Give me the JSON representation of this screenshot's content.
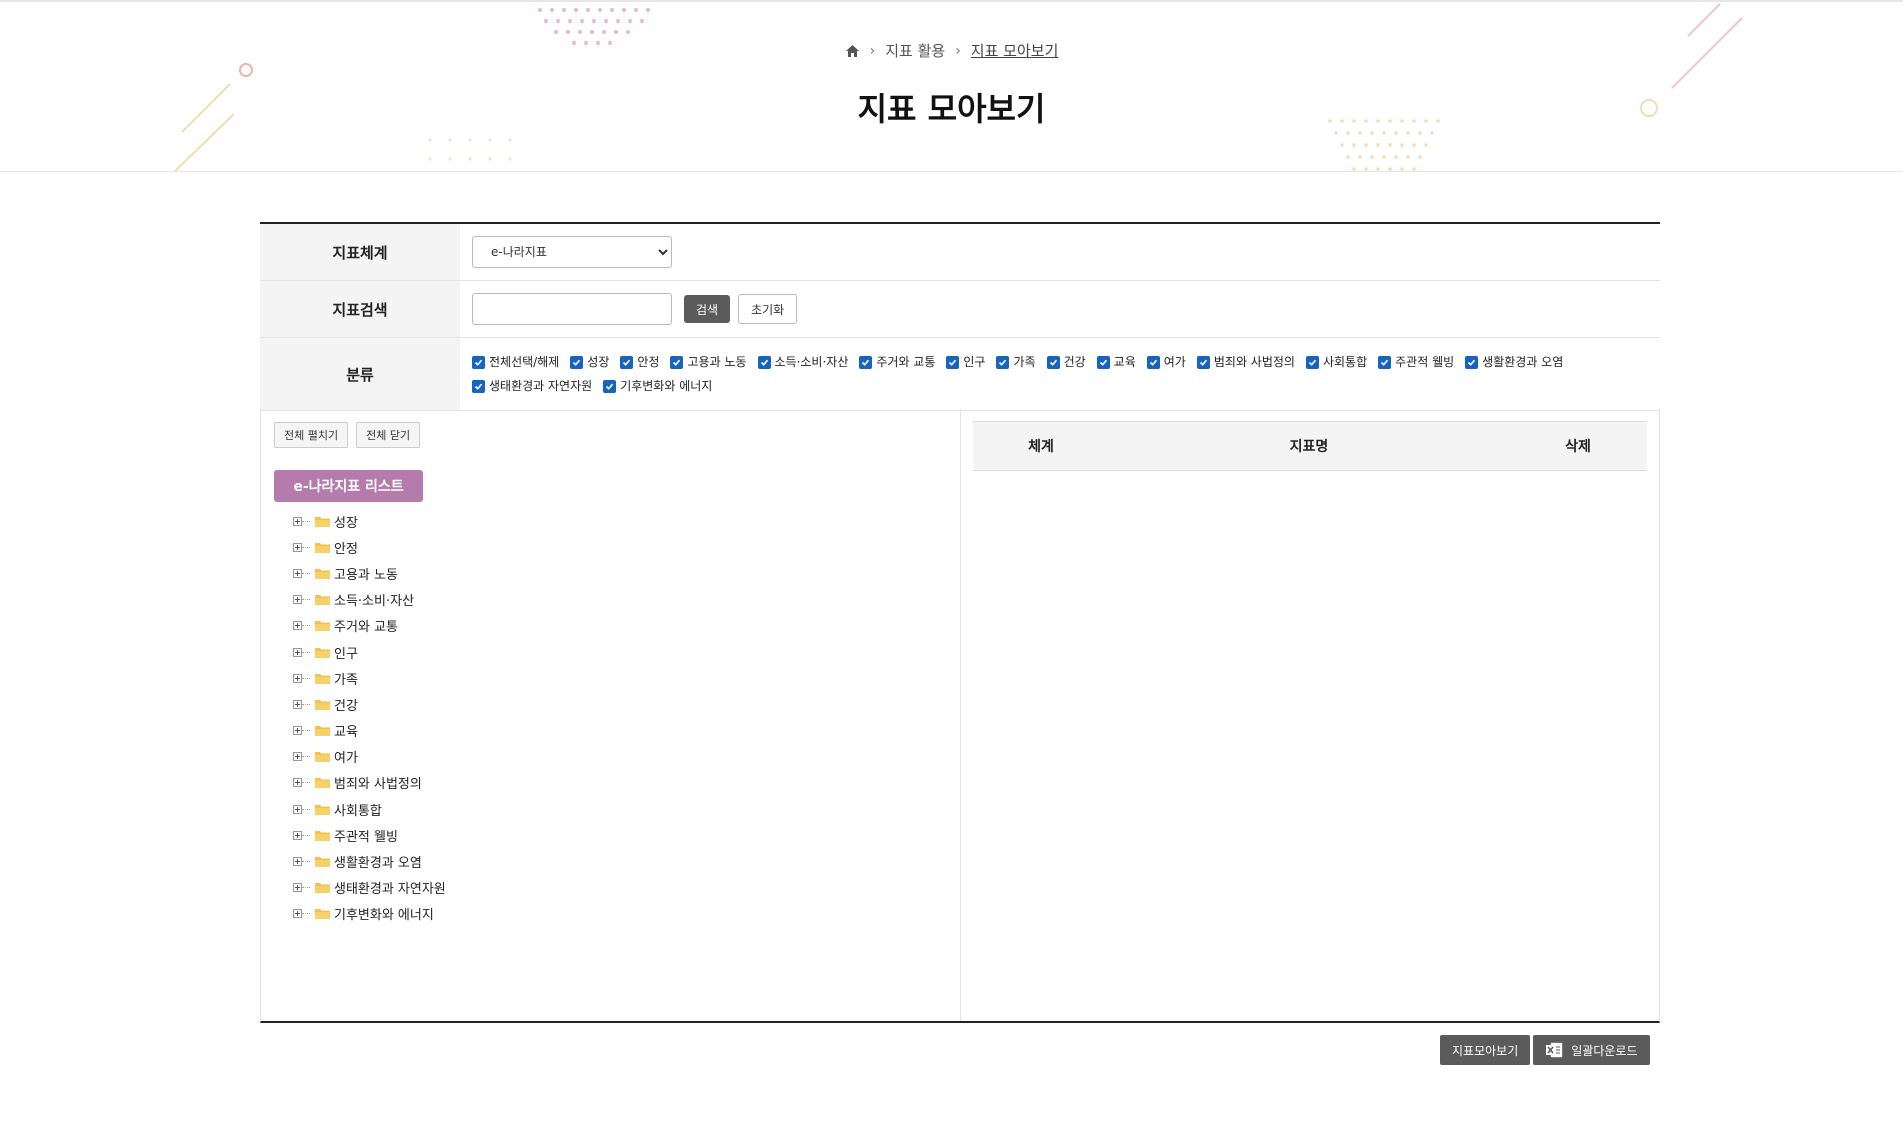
{
  "breadcrumb": {
    "level1": "지표 활용",
    "level2": "지표 모아보기"
  },
  "page_title": "지표 모아보기",
  "form": {
    "system_label": "지표체계",
    "system_selected": "e-나라지표",
    "search_label": "지표검색",
    "search_value": "",
    "search_button": "검색",
    "reset_button": "초기화",
    "category_label": "분류",
    "categories": [
      "전체선택/해제",
      "성장",
      "안정",
      "고용과 노동",
      "소득·소비·자산",
      "주거와 교통",
      "인구",
      "가족",
      "건강",
      "교육",
      "여가",
      "범죄와 사법정의",
      "사회통합",
      "주관적 웰빙",
      "생활환경과 오염",
      "생태환경과 자연자원",
      "기후변화와 에너지"
    ]
  },
  "left_panel": {
    "expand_all": "전체 펼치기",
    "collapse_all": "전체 닫기",
    "list_title": "e-나라지표 리스트",
    "tree_items": [
      "성장",
      "안정",
      "고용과 노동",
      "소득·소비·자산",
      "주거와 교통",
      "인구",
      "가족",
      "건강",
      "교육",
      "여가",
      "범죄와 사법정의",
      "사회통합",
      "주관적 웰빙",
      "생활환경과 오염",
      "생태환경과 자연자원",
      "기후변화와 에너지"
    ]
  },
  "right_panel": {
    "col_system": "체계",
    "col_name": "지표명",
    "col_delete": "삭제"
  },
  "bottom": {
    "view_button": "지표모아보기",
    "download_button": "일괄다운로드"
  }
}
